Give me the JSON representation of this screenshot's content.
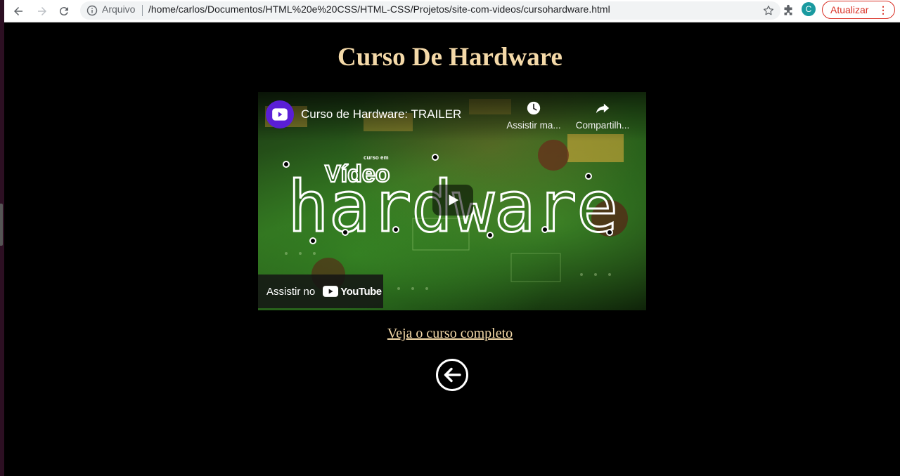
{
  "browser": {
    "scheme_label": "Arquivo",
    "url": "/home/carlos/Documentos/HTML%20e%20CSS/HTML-CSS/Projetos/site-com-videos/cursohardware.html",
    "profile_initial": "C",
    "update_label": "Atualizar",
    "colors": {
      "update": "#d93025",
      "avatar": "#1a9aa0"
    }
  },
  "page": {
    "title": "Curso De Hardware",
    "course_link": "Veja o curso completo",
    "colors": {
      "text": "#f4d9a8",
      "background": "#000000"
    }
  },
  "video": {
    "title": "Curso de Hardware: TRAILER",
    "watch_later_label": "Assistir ma...",
    "share_label": "Compartilh...",
    "watch_on_label": "Assistir no",
    "youtube_label": "YouTube",
    "thumbnail_text_top": "Vídeo",
    "thumbnail_text_tag": "curso em",
    "thumbnail_text_main": "hardware"
  },
  "icons": {
    "back": "arrow-left-icon",
    "forward": "arrow-right-icon",
    "reload": "reload-icon",
    "info": "info-icon",
    "star": "star-icon",
    "extensions": "puzzle-icon",
    "menu": "kebab-menu-icon",
    "clock": "clock-icon",
    "share": "share-icon",
    "play": "play-icon",
    "page_back": "circle-arrow-left-icon"
  }
}
